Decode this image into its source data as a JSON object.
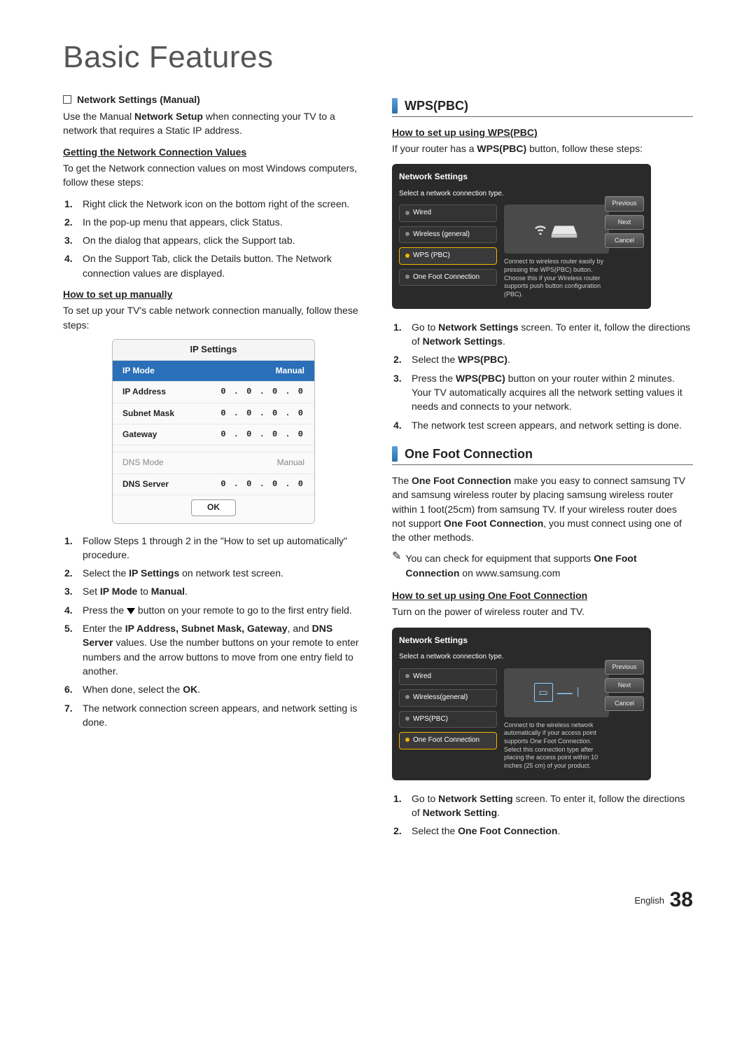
{
  "page_title": "Basic Features",
  "footer": {
    "lang": "English",
    "page": "38"
  },
  "left": {
    "ns_manual_label": "Network Settings (Manual)",
    "ns_manual_desc_a": "Use the Manual ",
    "ns_manual_desc_b": "Network Setup",
    "ns_manual_desc_c": " when connecting your TV to a network that requires a Static IP address.",
    "getting_heading": "Getting the Network Connection Values",
    "getting_intro": "To get the Network connection values on most Windows computers, follow these steps:",
    "getting_steps": [
      "Right click the Network icon on the bottom right of the screen.",
      "In the pop-up menu that appears, click Status.",
      "On the dialog that appears, click the Support tab.",
      "On the Support Tab, click the Details button. The Network connection values are displayed."
    ],
    "manual_heading": "How to set up manually",
    "manual_intro": "To set up your TV's cable network connection manually, follow these steps:",
    "ip_table": {
      "title": "IP Settings",
      "rows": [
        {
          "label": "IP Mode",
          "value": "Manual",
          "header": true
        },
        {
          "label": "IP Address",
          "value": "0 . 0 . 0 . 0"
        },
        {
          "label": "Subnet Mask",
          "value": "0 . 0 . 0 . 0"
        },
        {
          "label": "Gateway",
          "value": "0 . 0 . 0 . 0"
        },
        {
          "label": "DNS Mode",
          "value": "Manual",
          "gray": true
        },
        {
          "label": "DNS Server",
          "value": "0 . 0 . 0 . 0"
        }
      ],
      "ok": "OK"
    },
    "manual_steps": {
      "s1": "Follow Steps 1 through 2 in the \"How to set up automatically\" procedure.",
      "s2_a": "Select the ",
      "s2_b": "IP Settings",
      "s2_c": " on network test screen.",
      "s3_a": "Set ",
      "s3_b": "IP Mode",
      "s3_c": " to ",
      "s3_d": "Manual",
      "s3_e": ".",
      "s4_a": "Press the ",
      "s4_b": " button on your remote to go to the first entry field.",
      "s5_a": "Enter the ",
      "s5_b": "IP Address, Subnet Mask, Gateway",
      "s5_c": ", and ",
      "s5_d": "DNS Server",
      "s5_e": " values. Use the number buttons on your remote to enter numbers and the arrow buttons to move from one entry field to another.",
      "s6_a": "When done, select the ",
      "s6_b": "OK",
      "s6_c": ".",
      "s7": "The network connection screen appears, and network setting is done."
    }
  },
  "right": {
    "wps_title": "WPS(PBC)",
    "wps_sub": "How to set up using WPS(PBC)",
    "wps_intro_a": "If your router has a ",
    "wps_intro_b": "WPS(PBC)",
    "wps_intro_c": " button, follow these steps:",
    "ns_box_wps": {
      "title": "Network Settings",
      "sub": "Select a network connection type.",
      "items": [
        "Wired",
        "Wireless (general)",
        "WPS (PBC)",
        "One Foot Connection"
      ],
      "selected": 2,
      "desc": "Connect to wireless router easily by pressing the WPS(PBC) button. Choose this if your Wireless router supports push button configuration (PBC).",
      "btns": [
        "Previous",
        "Next",
        "Cancel"
      ]
    },
    "wps_steps": {
      "s1_a": "Go to ",
      "s1_b": "Network Settings",
      "s1_c": " screen. To enter it, follow the directions of ",
      "s1_d": "Network Settings",
      "s1_e": ".",
      "s2_a": "Select the ",
      "s2_b": "WPS(PBC)",
      "s2_c": ".",
      "s3_a": "Press the ",
      "s3_b": "WPS(PBC)",
      "s3_c": " button on your router within 2 minutes. Your TV automatically acquires all the network setting values it needs and connects to your network.",
      "s4": "The network test screen appears, and network setting is done."
    },
    "ofc_title": "One Foot Connection",
    "ofc_para_a": "The ",
    "ofc_para_b": "One Foot Connection",
    "ofc_para_c": " make you easy to connect samsung TV and samsung wireless router by placing samsung wireless router within 1 foot(25cm) from samsung TV. If your wireless router does not support ",
    "ofc_para_d": "One Foot Connection",
    "ofc_para_e": ", you must connect using one of the other methods.",
    "ofc_note_a": "You can check for equipment that supports ",
    "ofc_note_b": "One Foot Connection",
    "ofc_note_c": " on www.samsung.com",
    "ofc_sub": "How to set up using One Foot Connection",
    "ofc_intro": "Turn on the power of wireless router and TV.",
    "ns_box_ofc": {
      "title": "Network Settings",
      "sub": "Select a network connection type.",
      "items": [
        "Wired",
        "Wireless(general)",
        "WPS(PBC)",
        "One Foot Connection"
      ],
      "selected": 3,
      "desc": "Connect to the wireless network automatically if your access point supports One Foot Connection. Select this connection type after placing the access point within 10 inches (25 cm) of your product.",
      "btns": [
        "Previous",
        "Next",
        "Cancel"
      ]
    },
    "ofc_steps": {
      "s1_a": "Go to ",
      "s1_b": "Network Setting",
      "s1_c": " screen. To enter it, follow the directions of ",
      "s1_d": "Network Setting",
      "s1_e": ".",
      "s2_a": "Select the ",
      "s2_b": "One Foot Connection",
      "s2_c": "."
    }
  }
}
